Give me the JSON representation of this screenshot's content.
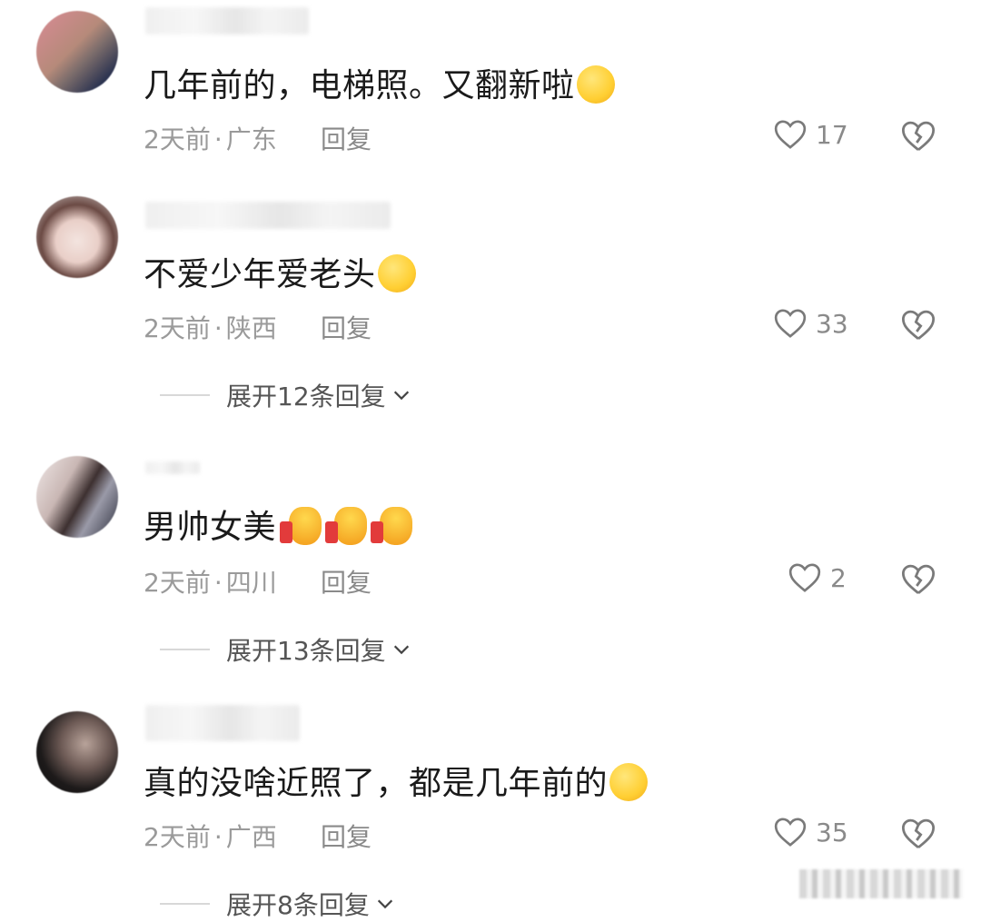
{
  "comments": [
    {
      "text": "几年前的，电梯照。又翻新啦",
      "emoji": [
        "smirk-face"
      ],
      "time": "2天前",
      "location": "广东",
      "reply_label": "回复",
      "likes": "17"
    },
    {
      "text": "不爱少年爱老头",
      "emoji": [
        "laughing-tears-face"
      ],
      "time": "2天前",
      "location": "陕西",
      "reply_label": "回复",
      "likes": "33",
      "expand_label": "展开12条回复"
    },
    {
      "text": "男帅女美",
      "emoji": [
        "thumbs-up",
        "thumbs-up",
        "thumbs-up"
      ],
      "time": "2天前",
      "location": "四川",
      "reply_label": "回复",
      "likes": "2",
      "expand_label": "展开13条回复"
    },
    {
      "text": "真的没啥近照了，都是几年前的",
      "emoji": [
        "facepalm-face"
      ],
      "time": "2天前",
      "location": "广西",
      "reply_label": "回复",
      "likes": "35",
      "expand_label": "展开8条回复"
    }
  ],
  "separator": "·",
  "colors": {
    "meta": "#9a9a9a",
    "text": "#1a1a1a",
    "icon": "#7a7a7a"
  }
}
